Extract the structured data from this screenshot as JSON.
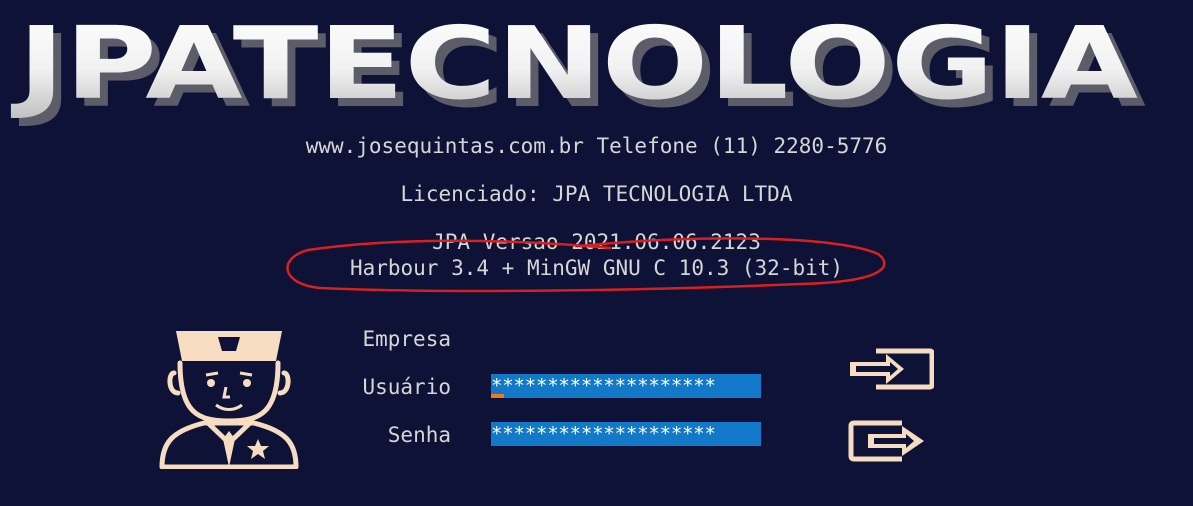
{
  "logo": {
    "text": "JPATECNOLOGIA"
  },
  "header": {
    "site_line": "www.josequintas.com.br Telefone (11) 2280-5776",
    "license_line": "Licenciado: JPA TECNOLOGIA LTDA",
    "version_line": "JPA Versao 2021.06.06.2123",
    "compiler_line": "Harbour 3.4 + MinGW GNU C 10.3 (32-bit)"
  },
  "form": {
    "company_label": "Empresa",
    "user_label": "Usuário",
    "password_label": "Senha",
    "user_value": "********************",
    "password_value": "********************"
  },
  "icons": {
    "avatar": "police-officer-icon",
    "login_button": "login-arrow-icon",
    "exit_button": "exit-arrow-icon"
  },
  "colors": {
    "background": "#0e1236",
    "field_bg": "#1278c8",
    "cursor": "#f07a1a",
    "icon_fill": "#f6dcc0",
    "annotation": "#d9201e"
  }
}
